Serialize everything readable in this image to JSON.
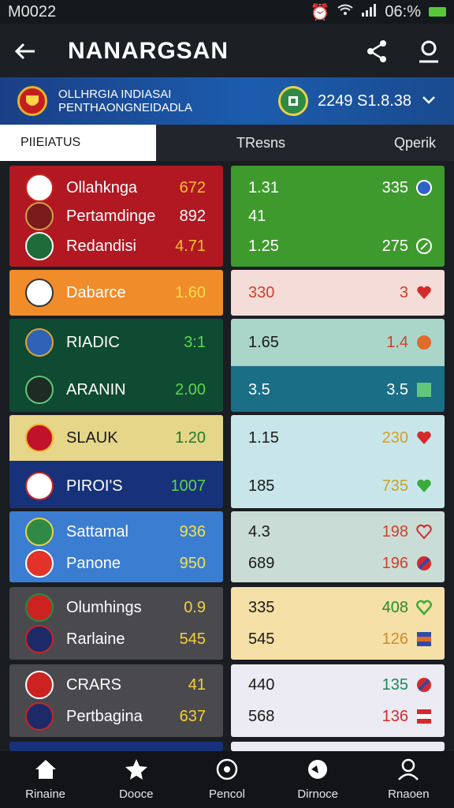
{
  "status_bar": {
    "time": "M0022",
    "battery": "06:%"
  },
  "app_bar": {
    "title": "NANARGSAN"
  },
  "banner": {
    "line1": "OLLHRGIA INDIASAI",
    "line2": "PENTHAONGNEIDADLA",
    "score": "2249 S1.8.38"
  },
  "tabs": {
    "active": "PIIEIATUS",
    "t2": "TResns",
    "t3": "Qperik"
  },
  "left_rows": [
    {
      "name": "Ollahknga",
      "value": "672"
    },
    {
      "name": "Pertamdinge",
      "value": "892"
    },
    {
      "name": "Redandisi",
      "value": "4.71"
    },
    {
      "name": "Dabarce",
      "value": "1.60"
    },
    {
      "name": "RIADIC",
      "value": "3:1"
    },
    {
      "name": "ARANIN",
      "value": "2.00"
    },
    {
      "name": "SLAUK",
      "value": "1.20"
    },
    {
      "name": "PIROI'S",
      "value": "1007"
    },
    {
      "name": "Sattamal",
      "value": "936"
    },
    {
      "name": "Panone",
      "value": "950"
    },
    {
      "name": "Olumhings",
      "value": "0.9"
    },
    {
      "name": "Rarlaine",
      "value": "545"
    },
    {
      "name": "CRARS",
      "value": "41"
    },
    {
      "name": "Pertbagina",
      "value": "637"
    }
  ],
  "right_rows": [
    {
      "left": "1.31",
      "right": "335"
    },
    {
      "left": "41",
      "right": ""
    },
    {
      "left": "1.25",
      "right": "275"
    },
    {
      "left": "330",
      "right": "3"
    },
    {
      "left": "1.65",
      "right": "1.4"
    },
    {
      "left": "3.5",
      "right": "3.5"
    },
    {
      "left": "1.15",
      "right": "230"
    },
    {
      "left": "185",
      "right": "735"
    },
    {
      "left": "4.3",
      "right": "198"
    },
    {
      "left": "689",
      "right": "196"
    },
    {
      "left": "335",
      "right": "408"
    },
    {
      "left": "545",
      "right": "126"
    },
    {
      "left": "440",
      "right": "135"
    },
    {
      "left": "568",
      "right": "136"
    }
  ],
  "bottom_nav": [
    {
      "label": "Rinaine",
      "icon": "home-icon"
    },
    {
      "label": "Dooce",
      "icon": "star-icon"
    },
    {
      "label": "Pencol",
      "icon": "ball-icon"
    },
    {
      "label": "Dirnoce",
      "icon": "globe-icon"
    },
    {
      "label": "Rnaoen",
      "icon": "profile-icon"
    }
  ]
}
